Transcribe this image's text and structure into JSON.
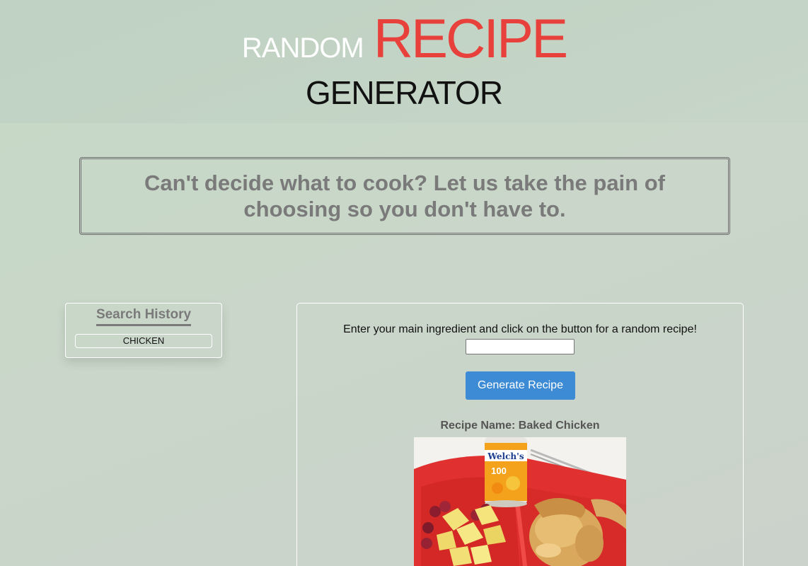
{
  "header": {
    "word_random": "RANDOM",
    "word_recipe": "RECIPE",
    "word_generator": "GENERATOR"
  },
  "tagline": "Can't decide what to cook? Let us take the pain of choosing so you don't have to.",
  "search_history": {
    "title": "Search History",
    "items": [
      "CHICKEN"
    ]
  },
  "recipe_form": {
    "prompt": "Enter your main ingredient and click on the button for a random recipe!",
    "input_value": "",
    "input_placeholder": "",
    "button_label": "Generate Recipe"
  },
  "result": {
    "recipe_name_label": "Recipe Name:",
    "recipe_name": "Baked Chicken",
    "image_can_label": "Welch's",
    "image_can_number": "100"
  },
  "colors": {
    "accent_red": "#e8413c",
    "button_blue": "#3d8bd4"
  }
}
